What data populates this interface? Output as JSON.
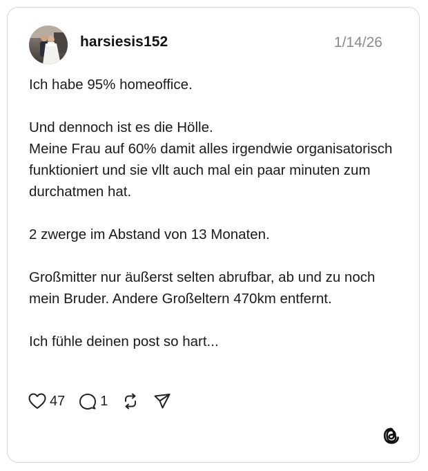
{
  "post": {
    "username": "harsiesis152",
    "date": "1/14/26",
    "paragraphs": [
      "Ich habe 95% homeoffice.",
      "Und dennoch ist es die Hölle.\nMeine Frau auf 60% damit alles irgendwie organisatorisch funktioniert und sie vllt auch mal ein paar minuten zum durchatmen hat.",
      "2 zwerge im Abstand von 13 Monaten.",
      "Großmitter nur äußerst selten abrufbar, ab und zu noch mein Bruder. Andere Großeltern 470km entfernt.",
      "Ich fühle deinen post so hart..."
    ],
    "actions": {
      "likes": "47",
      "replies": "1"
    }
  },
  "icons": {
    "like": "heart-icon",
    "reply": "speech-bubble-icon",
    "repost": "repost-arrows-icon",
    "share": "send-icon",
    "brand": "threads-logo-icon"
  }
}
